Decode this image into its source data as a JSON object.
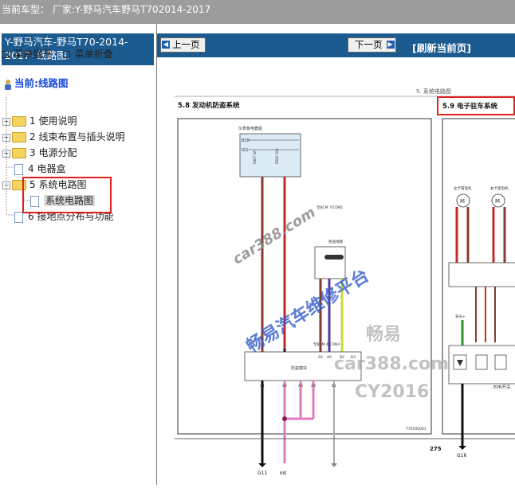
{
  "topbar": {
    "text": "当前车型：  厂家:Y-野马汽车野马T702014-2017"
  },
  "left": {
    "title": "Y-野马汽车-野马T70-2014-2017- 线路图.",
    "expand_label": "菜单展开",
    "collapse_label": "菜单折叠",
    "current_label": "当前:线路图",
    "tree": [
      {
        "label": "1 使用说明"
      },
      {
        "label": "2 线束布置与插头说明"
      },
      {
        "label": "3 电源分配"
      },
      {
        "label": "4 电器盒"
      },
      {
        "label": "5 系统电路图"
      },
      {
        "label": "系统电路图"
      },
      {
        "label": "6 接地点分布与功能"
      }
    ]
  },
  "nav": {
    "prev": "上一页",
    "next": "下一页",
    "refresh": "[刷新当前页]"
  },
  "diagram": {
    "header": "5. 系统电路图",
    "left_title": "5.8 发动机防盗系统",
    "right_title": "5.9 电子驻车系统",
    "page_number": "275",
    "doc_code": "T70500001",
    "left_labels": {
      "panel": "仪表板电器盒",
      "b30": "B30",
      "ig1": "IG1",
      "fuse1": "FB07 5A",
      "fuse2": "FB06 10A",
      "bcm": "至BCM 7/CON1",
      "coil": "防盗线圈",
      "module": "防盗模块",
      "ground": "G11",
      "kline": "K线",
      "bcm2": "至BCM 4/CON4",
      "pins": [
        "A1",
        "A2",
        "A3",
        "A4",
        "A5",
        "A6",
        "B1",
        "B2",
        "B3"
      ]
    },
    "right_labels": {
      "motor_l": "左卡钳电机",
      "motor_r": "右卡钳电机",
      "epb": "EPB开关",
      "ground": "G16",
      "wire": "背光+"
    }
  },
  "watermarks": {
    "w1": "car388.com",
    "w2": "畅易汽车维修平台",
    "w3": "畅易",
    "w4": "car388.com",
    "w5": "CY2016"
  },
  "colors": {
    "nav_blue": "#1c5b8f",
    "highlight_red": "#e0201b",
    "tree_blue": "#1a49d8"
  }
}
